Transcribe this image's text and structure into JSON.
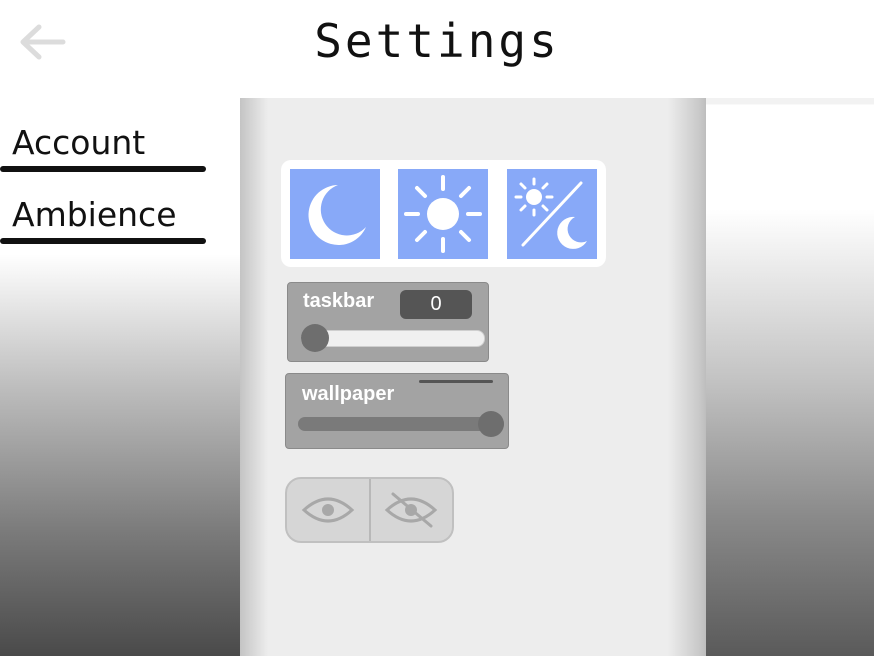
{
  "header": {
    "title": "Settings",
    "back_icon": "arrow-left-icon"
  },
  "sidebar": {
    "items": [
      {
        "label": "Account"
      },
      {
        "label": "Ambience"
      }
    ]
  },
  "theme": {
    "options": [
      {
        "icon": "moon-icon"
      },
      {
        "icon": "sun-icon"
      },
      {
        "icon": "sun-moon-icon"
      }
    ],
    "accent": "#88a9f8"
  },
  "sliders": {
    "taskbar": {
      "label": "taskbar",
      "value": "0",
      "fraction": 0
    },
    "wallpaper": {
      "label": "wallpaper",
      "fraction": 1
    }
  },
  "visibility": {
    "options": [
      {
        "icon": "eye-icon"
      },
      {
        "icon": "eye-off-icon"
      }
    ]
  }
}
